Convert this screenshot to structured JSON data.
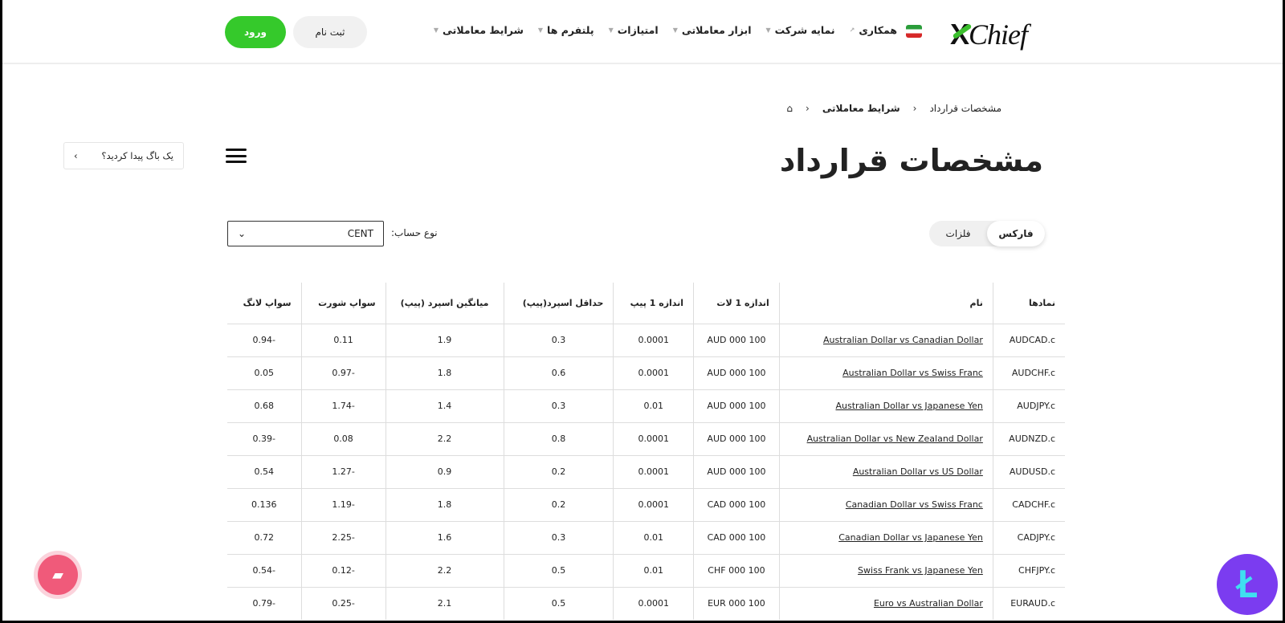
{
  "header": {
    "logo": "XChief",
    "nav": [
      {
        "label": "شرایط معاملاتی",
        "icon": "chevron-down-icon"
      },
      {
        "label": "پلتفرم ها",
        "icon": "chevron-down-icon"
      },
      {
        "label": "امتیازات",
        "icon": "chevron-down-icon"
      },
      {
        "label": "ابزار معاملاتی",
        "icon": "chevron-down-icon"
      },
      {
        "label": "نمایه شرکت",
        "icon": "chevron-down-icon"
      },
      {
        "label": "همکاری",
        "icon": "external-arrow-icon"
      }
    ],
    "register": "ثبت نام",
    "login": "ورود",
    "login_color": "#35c92b"
  },
  "breadcrumb": {
    "items": [
      "شرایط معاملاتی",
      "مشخصات قرارداد"
    ]
  },
  "page_title": "مشخصات قرارداد",
  "bug_report": "یک باگ پیدا کردید؟",
  "tabs": [
    {
      "label": "فارکس",
      "active": true
    },
    {
      "label": "فلزات",
      "active": false
    }
  ],
  "account": {
    "label": "نوع حساب:",
    "value": "CENT"
  },
  "table": {
    "headers": [
      "نمادها",
      "نام",
      "اندازه 1 لات",
      "اندازه 1 پیپ",
      "حداقل اسپرد(پیپ)",
      "میانگین اسپرد (پیپ)",
      "سواپ شورت",
      "سواپ لانگ"
    ],
    "rows": [
      [
        "AUDCAD.c",
        "Australian Dollar vs Canadian Dollar",
        "100 000 AUD",
        "0.0001",
        "0.3",
        "1.9",
        "0.11",
        "-0.94"
      ],
      [
        "AUDCHF.c",
        "Australian Dollar vs Swiss Franc",
        "100 000 AUD",
        "0.0001",
        "0.6",
        "1.8",
        "-0.97",
        "0.05"
      ],
      [
        "AUDJPY.c",
        "Australian Dollar vs Japanese Yen",
        "100 000 AUD",
        "0.01",
        "0.3",
        "1.4",
        "-1.74",
        "0.68"
      ],
      [
        "AUDNZD.c",
        "Australian Dollar vs New Zealand Dollar",
        "100 000 AUD",
        "0.0001",
        "0.8",
        "2.2",
        "0.08",
        "-0.39"
      ],
      [
        "AUDUSD.c",
        "Australian Dollar vs US Dollar",
        "100 000 AUD",
        "0.0001",
        "0.2",
        "0.9",
        "-1.27",
        "0.54"
      ],
      [
        "CADCHF.c",
        "Canadian Dollar vs Swiss Franc",
        "100 000 CAD",
        "0.0001",
        "0.2",
        "1.8",
        "-1.19",
        "0.136"
      ],
      [
        "CADJPY.c",
        "Canadian Dollar vs Japanese Yen",
        "100 000 CAD",
        "0.01",
        "0.3",
        "1.6",
        "-2.25",
        "0.72"
      ],
      [
        "CHFJPY.c",
        "Swiss Frank vs Japanese Yen",
        "100 000 CHF",
        "0.01",
        "0.5",
        "2.2",
        "-0.12",
        "-0.54"
      ],
      [
        "EURAUD.c",
        "Euro vs Australian Dollar",
        "100 000 EUR",
        "0.0001",
        "0.5",
        "2.1",
        "-0.25",
        "-0.79"
      ]
    ]
  }
}
